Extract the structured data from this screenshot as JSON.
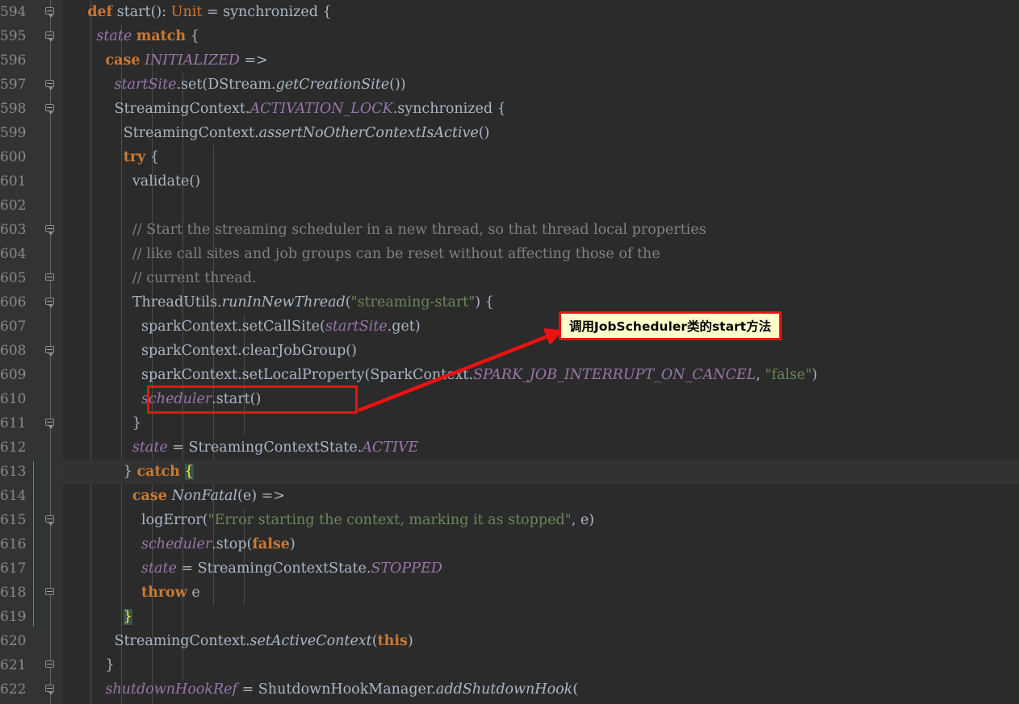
{
  "editor": {
    "background_color": "#2b2b2b",
    "gutter_color": "#313335",
    "current_line_color": "#323232",
    "first_line_number": 594,
    "last_line_number": 622,
    "language": "Scala",
    "current_line": 613
  },
  "colors": {
    "keyword": "#cc7832",
    "field": "#9876aa",
    "string": "#6a8759",
    "comment": "#808080",
    "plain": "#a9b7c6",
    "brace_match_bg": "#3b514d",
    "brace_match_fg": "#ffef28",
    "annotation_red": "#ee1111",
    "callout_bg": "#ffffcc",
    "brace_guide": "#5b8a72"
  },
  "lines": [
    {
      "n": "594",
      "fold": "arrow",
      "current": false,
      "tokens": [
        {
          "t": "    ",
          "c": "pln"
        },
        {
          "t": "def",
          "c": "kw"
        },
        {
          "t": " start",
          "c": "pln"
        },
        {
          "t": "()",
          "c": "pln"
        },
        {
          "t": ": ",
          "c": "pln"
        },
        {
          "t": "Unit",
          "c": "kw2"
        },
        {
          "t": " = synchronized {",
          "c": "pln"
        }
      ]
    },
    {
      "n": "595",
      "fold": "arrow",
      "current": false,
      "tokens": [
        {
          "t": "      ",
          "c": "pln"
        },
        {
          "t": "state",
          "c": "fld"
        },
        {
          "t": " ",
          "c": "pln"
        },
        {
          "t": "match",
          "c": "kw"
        },
        {
          "t": " {",
          "c": "pln"
        }
      ]
    },
    {
      "n": "596",
      "fold": "",
      "current": false,
      "tokens": [
        {
          "t": "        ",
          "c": "pln"
        },
        {
          "t": "case",
          "c": "kw"
        },
        {
          "t": " ",
          "c": "pln"
        },
        {
          "t": "INITIALIZED",
          "c": "fld"
        },
        {
          "t": " =>",
          "c": "pln"
        }
      ]
    },
    {
      "n": "597",
      "fold": "arrow",
      "current": false,
      "tokens": [
        {
          "t": "          ",
          "c": "pln"
        },
        {
          "t": "startSite",
          "c": "fld"
        },
        {
          "t": ".set(DStream.",
          "c": "pln"
        },
        {
          "t": "getCreationSite",
          "c": "mthi"
        },
        {
          "t": "())",
          "c": "pln"
        }
      ]
    },
    {
      "n": "598",
      "fold": "arrow",
      "current": false,
      "tokens": [
        {
          "t": "          StreamingContext.",
          "c": "pln"
        },
        {
          "t": "ACTIVATION_LOCK",
          "c": "fld"
        },
        {
          "t": ".synchronized {",
          "c": "pln"
        }
      ]
    },
    {
      "n": "599",
      "fold": "",
      "current": false,
      "tokens": [
        {
          "t": "            StreamingContext.",
          "c": "pln"
        },
        {
          "t": "assertNoOtherContextIsActive",
          "c": "mthi"
        },
        {
          "t": "()",
          "c": "pln"
        }
      ]
    },
    {
      "n": "600",
      "fold": "",
      "current": false,
      "tokens": [
        {
          "t": "            ",
          "c": "pln"
        },
        {
          "t": "try",
          "c": "kw"
        },
        {
          "t": " {",
          "c": "pln"
        }
      ]
    },
    {
      "n": "601",
      "fold": "",
      "current": false,
      "tokens": [
        {
          "t": "              validate()",
          "c": "pln"
        }
      ]
    },
    {
      "n": "602",
      "fold": "",
      "current": false,
      "tokens": []
    },
    {
      "n": "603",
      "fold": "arrow",
      "current": false,
      "tokens": [
        {
          "t": "              // Start the streaming scheduler in a new thread, so that thread local properties",
          "c": "cmt"
        }
      ]
    },
    {
      "n": "604",
      "fold": "",
      "current": false,
      "tokens": [
        {
          "t": "              // like call sites and job groups can be reset without affecting those of the",
          "c": "cmt"
        }
      ]
    },
    {
      "n": "605",
      "fold": "plain",
      "current": false,
      "tokens": [
        {
          "t": "              // current thread.",
          "c": "cmt"
        }
      ]
    },
    {
      "n": "606",
      "fold": "arrow",
      "current": false,
      "tokens": [
        {
          "t": "              ThreadUtils.",
          "c": "pln"
        },
        {
          "t": "runInNewThread",
          "c": "mthi"
        },
        {
          "t": "(",
          "c": "pln"
        },
        {
          "t": "\"streaming-start\"",
          "c": "str"
        },
        {
          "t": ") {",
          "c": "pln"
        }
      ]
    },
    {
      "n": "607",
      "fold": "",
      "current": false,
      "tokens": [
        {
          "t": "                sparkContext.setCallSite(",
          "c": "pln"
        },
        {
          "t": "startSite",
          "c": "fld"
        },
        {
          "t": ".get)",
          "c": "pln"
        }
      ]
    },
    {
      "n": "608",
      "fold": "arrow",
      "current": false,
      "tokens": [
        {
          "t": "                sparkContext.clearJobGroup()",
          "c": "pln"
        }
      ]
    },
    {
      "n": "609",
      "fold": "",
      "current": false,
      "tokens": [
        {
          "t": "                sparkContext.setLocalProperty(SparkContext.",
          "c": "pln"
        },
        {
          "t": "SPARK_JOB_INTERRUPT_ON_CANCEL",
          "c": "fld"
        },
        {
          "t": ", ",
          "c": "pln"
        },
        {
          "t": "\"false\"",
          "c": "str"
        },
        {
          "t": ")",
          "c": "pln"
        }
      ]
    },
    {
      "n": "610",
      "fold": "",
      "current": false,
      "tokens": [
        {
          "t": "                ",
          "c": "pln"
        },
        {
          "t": "scheduler",
          "c": "fld"
        },
        {
          "t": ".start()",
          "c": "pln"
        }
      ]
    },
    {
      "n": "611",
      "fold": "arrow",
      "current": false,
      "tokens": [
        {
          "t": "              }",
          "c": "pln"
        }
      ]
    },
    {
      "n": "612",
      "fold": "",
      "current": false,
      "tokens": [
        {
          "t": "              ",
          "c": "pln"
        },
        {
          "t": "state",
          "c": "fld"
        },
        {
          "t": " = StreamingContextState.",
          "c": "pln"
        },
        {
          "t": "ACTIVE",
          "c": "fld"
        }
      ]
    },
    {
      "n": "613",
      "fold": "",
      "current": true,
      "tokens": [
        {
          "t": "            } ",
          "c": "pln"
        },
        {
          "t": "catch",
          "c": "kw"
        },
        {
          "t": " ",
          "c": "pln"
        },
        {
          "t": "{",
          "c": "bmatch"
        }
      ]
    },
    {
      "n": "614",
      "fold": "",
      "current": false,
      "tokens": [
        {
          "t": "              ",
          "c": "pln"
        },
        {
          "t": "case",
          "c": "kw"
        },
        {
          "t": " ",
          "c": "pln"
        },
        {
          "t": "NonFatal",
          "c": "mthi"
        },
        {
          "t": "(e) =>",
          "c": "pln"
        }
      ]
    },
    {
      "n": "615",
      "fold": "arrow",
      "current": false,
      "tokens": [
        {
          "t": "                logError(",
          "c": "pln"
        },
        {
          "t": "\"Error starting the context, marking it as stopped\"",
          "c": "str"
        },
        {
          "t": ", e)",
          "c": "pln"
        }
      ]
    },
    {
      "n": "616",
      "fold": "",
      "current": false,
      "tokens": [
        {
          "t": "                ",
          "c": "pln"
        },
        {
          "t": "scheduler",
          "c": "fld"
        },
        {
          "t": ".stop(",
          "c": "pln"
        },
        {
          "t": "false",
          "c": "kw"
        },
        {
          "t": ")",
          "c": "pln"
        }
      ]
    },
    {
      "n": "617",
      "fold": "",
      "current": false,
      "tokens": [
        {
          "t": "                ",
          "c": "pln"
        },
        {
          "t": "state",
          "c": "fld"
        },
        {
          "t": " = StreamingContextState.",
          "c": "pln"
        },
        {
          "t": "STOPPED",
          "c": "fld"
        }
      ]
    },
    {
      "n": "618",
      "fold": "plain",
      "current": false,
      "tokens": [
        {
          "t": "                ",
          "c": "pln"
        },
        {
          "t": "throw",
          "c": "kw"
        },
        {
          "t": " e",
          "c": "pln"
        }
      ]
    },
    {
      "n": "619",
      "fold": "",
      "current": false,
      "tokens": [
        {
          "t": "            ",
          "c": "pln"
        },
        {
          "t": "}",
          "c": "bmatch"
        }
      ]
    },
    {
      "n": "620",
      "fold": "",
      "current": false,
      "tokens": [
        {
          "t": "          StreamingContext.",
          "c": "pln"
        },
        {
          "t": "setActiveContext",
          "c": "mthi"
        },
        {
          "t": "(",
          "c": "pln"
        },
        {
          "t": "this",
          "c": "kw"
        },
        {
          "t": ")",
          "c": "pln"
        }
      ]
    },
    {
      "n": "621",
      "fold": "plain",
      "current": false,
      "tokens": [
        {
          "t": "        }",
          "c": "pln"
        }
      ]
    },
    {
      "n": "622",
      "fold": "arrow",
      "current": false,
      "tokens": [
        {
          "t": "        ",
          "c": "pln"
        },
        {
          "t": "shutdownHookRef",
          "c": "fld"
        },
        {
          "t": " = ShutdownHookManager.",
          "c": "pln"
        },
        {
          "t": "addShutdownHook",
          "c": "mthi"
        },
        {
          "t": "(",
          "c": "pln"
        }
      ]
    }
  ],
  "annotations": {
    "callout": {
      "text": "调用JobScheduler类的start方法"
    },
    "highlight_target_line": "610",
    "highlight_target_code": "scheduler.start()"
  }
}
